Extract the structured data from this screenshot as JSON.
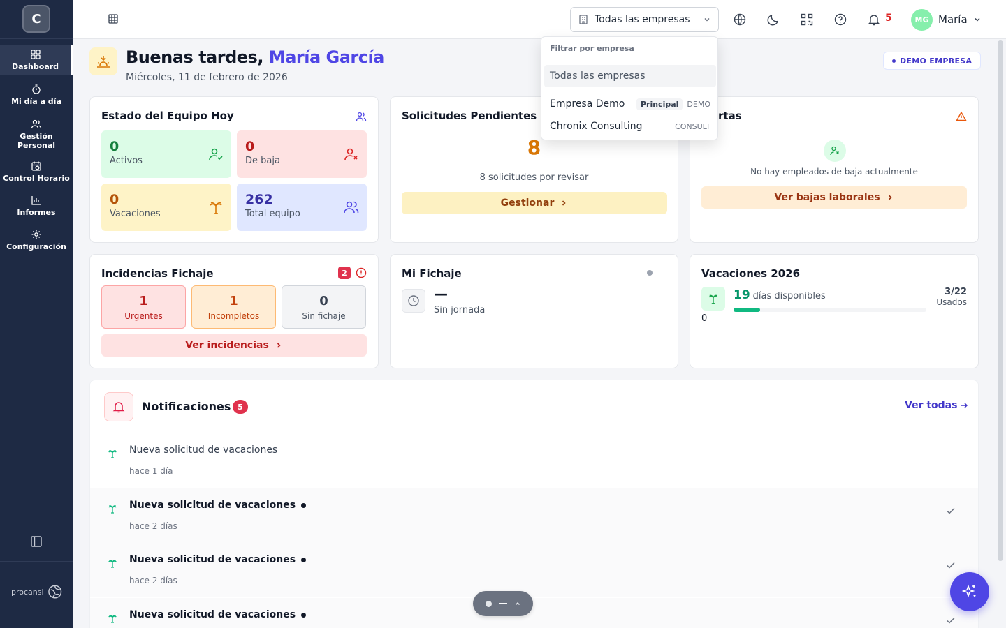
{
  "sidebar": {
    "logo_letter": "C",
    "items": [
      {
        "label": "Dashboard",
        "icon": "dashboard-icon"
      },
      {
        "label": "Mi día a día",
        "icon": "stopwatch-icon"
      },
      {
        "label": "Gestión Personal",
        "icon": "users-icon"
      },
      {
        "label": "Control Horario",
        "icon": "calendar-clock-icon"
      },
      {
        "label": "Informes",
        "icon": "bar-chart-icon"
      },
      {
        "label": "Configuración",
        "icon": "gear-icon"
      }
    ],
    "footer_brand": "procansi"
  },
  "topbar": {
    "company_select": "Todas las empresas",
    "notification_count": "5",
    "user_initials": "MG",
    "user_name": "María"
  },
  "header": {
    "greeting_prefix": "Buenas tardes,",
    "greeting_name": " María García",
    "date": "Miércoles, 11 de febrero de 2026",
    "badge": "DEMO EMPRESA"
  },
  "team_card": {
    "title": "Estado del Equipo Hoy",
    "stats": [
      {
        "value": "0",
        "label": "Activos"
      },
      {
        "value": "0",
        "label": "De baja"
      },
      {
        "value": "0",
        "label": "Vacaciones"
      },
      {
        "value": "262",
        "label": "Total equipo"
      }
    ]
  },
  "requests_card": {
    "title": "Solicitudes Pendientes",
    "count": "8",
    "subtitle": "8 solicitudes por revisar",
    "button": "Gestionar"
  },
  "alerts_card": {
    "title_visible": "rtas",
    "empty_text": "No hay empleados de baja actualmente",
    "button": "Ver bajas laborales"
  },
  "incidents_card": {
    "title": "Incidencias Fichaje",
    "badge": "2",
    "tiles": [
      {
        "value": "1",
        "label": "Urgentes"
      },
      {
        "value": "1",
        "label": "Incompletos"
      },
      {
        "value": "0",
        "label": "Sin fichaje"
      }
    ],
    "button": "Ver incidencias"
  },
  "clock_card": {
    "title": "Mi Fichaje",
    "time": "—",
    "status": "Sin jornada"
  },
  "vacation_card": {
    "title": "Vacaciones 2026",
    "days": "19",
    "days_label": "días disponibles",
    "ratio": "3/22",
    "used_label": "Usados",
    "zero_label": "0",
    "progress_fraction": 0.136
  },
  "dropdown": {
    "header": "Filtrar por empresa",
    "options": [
      {
        "name": "Todas las empresas",
        "pill": "",
        "tag": ""
      },
      {
        "name": "Empresa Demo",
        "pill": "Principal",
        "tag": "DEMO"
      },
      {
        "name": "Chronix Consulting",
        "pill": "",
        "tag": "CONSULT"
      }
    ]
  },
  "notifications": {
    "title": "Notificaciones",
    "count": "5",
    "see_all": "Ver todas",
    "items": [
      {
        "text": "Nueva solicitud de vacaciones",
        "time": "hace 1 día",
        "unread": false
      },
      {
        "text": "Nueva solicitud de vacaciones",
        "time": "hace 2 días",
        "unread": true
      },
      {
        "text": "Nueva solicitud de vacaciones",
        "time": "hace 2 días",
        "unread": true
      },
      {
        "text": "Nueva solicitud de vacaciones",
        "time": "",
        "unread": true
      }
    ]
  },
  "colors": {
    "sidebar": "#1e2a44",
    "accent": "#4f46e5",
    "green": "#15803d",
    "red": "#b91c1c",
    "amber": "#b45309"
  }
}
